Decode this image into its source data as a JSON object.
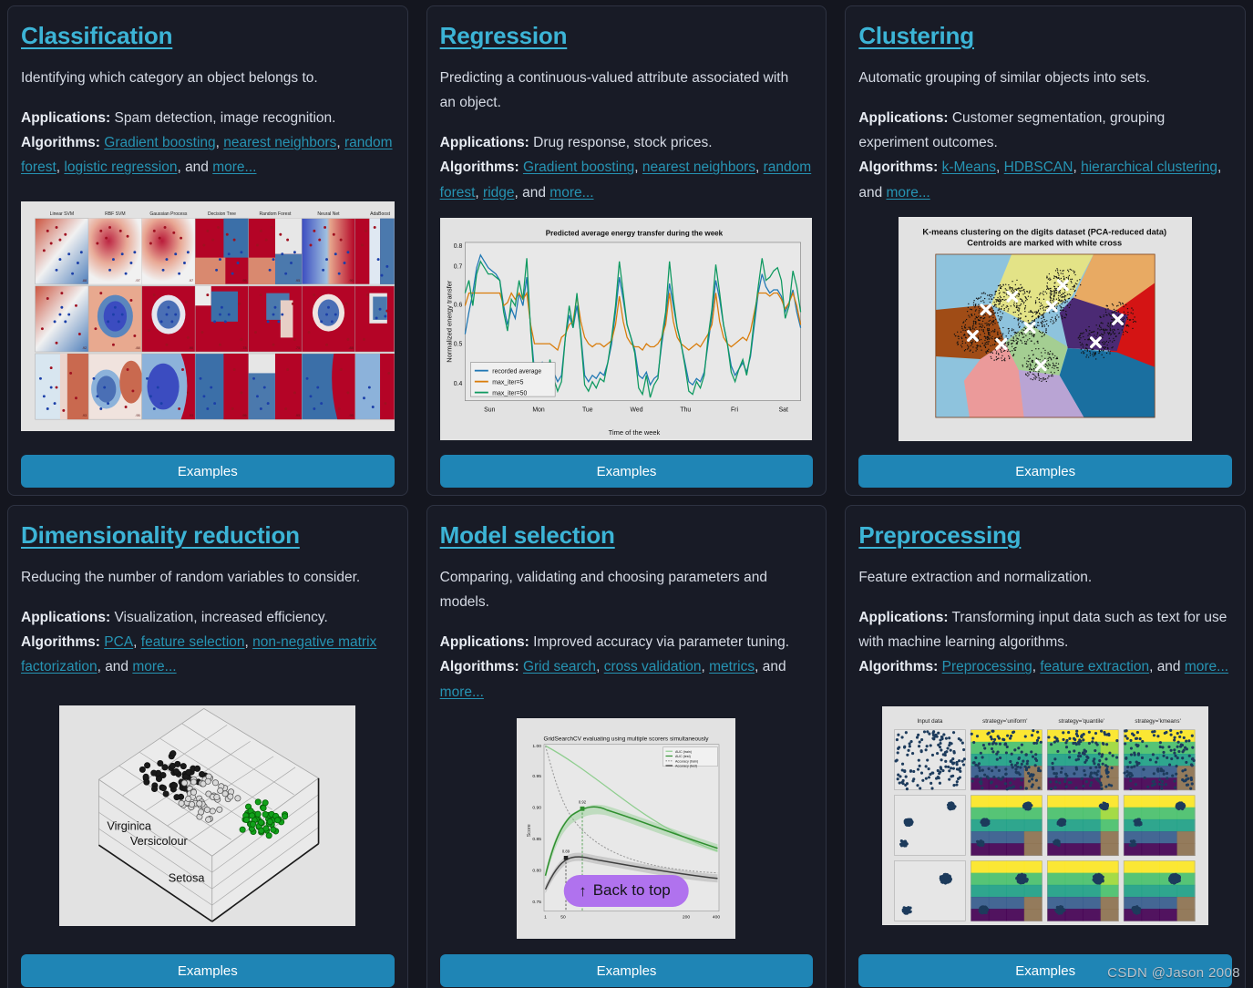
{
  "theme": {
    "page_bg": "#14161f",
    "card_bg": "#181b26",
    "card_border": "#2e3342",
    "heading_color": "#3cb4d6",
    "link_color": "#2694b3",
    "body_text": "#d5dae4",
    "button_bg": "#1f85b5",
    "back_to_top_bg": "#b072ee"
  },
  "labels": {
    "applications": "Applications:",
    "algorithms": "Algorithms:",
    "and": ", and ",
    "comma": ", ",
    "examples": "Examples",
    "back_to_top": "Back to top",
    "back_to_top_arrow": "↑",
    "watermark": "CSDN @Jason 2008"
  },
  "cards": [
    {
      "title": "Classification",
      "description": "Identifying which category an object belongs to.",
      "applications": "Spam detection, image recognition.",
      "algorithms": [
        "Gradient boosting",
        "nearest neighbors",
        "random forest",
        "logistic regression"
      ],
      "more": "more...",
      "button": "Examples",
      "figure": "classifier-comparison"
    },
    {
      "title": "Regression",
      "description": "Predicting a continuous-valued attribute associated with an object.",
      "applications": "Drug response, stock prices.",
      "algorithms": [
        "Gradient boosting",
        "nearest neighbors",
        "random forest",
        "ridge"
      ],
      "more": "more...",
      "button": "Examples",
      "figure": "energy-transfer-lines"
    },
    {
      "title": "Clustering",
      "description": "Automatic grouping of similar objects into sets.",
      "applications": "Customer segmentation, grouping experiment outcomes.",
      "algorithms": [
        "k-Means",
        "HDBSCAN",
        "hierarchical clustering"
      ],
      "more": "more...",
      "button": "Examples",
      "figure": "kmeans-voronoi"
    },
    {
      "title": "Dimensionality reduction",
      "description": "Reducing the number of random variables to consider.",
      "applications": "Visualization, increased efficiency.",
      "algorithms": [
        "PCA",
        "feature selection",
        "non-negative matrix factorization"
      ],
      "more": "more...",
      "button": "Examples",
      "figure": "iris-3d-pca"
    },
    {
      "title": "Model selection",
      "description": "Comparing, validating and choosing parameters and models.",
      "applications": "Improved accuracy via parameter tuning.",
      "algorithms": [
        "Grid search",
        "cross validation",
        "metrics"
      ],
      "more": "more...",
      "button": "Examples",
      "figure": "gridsearch-multiscore"
    },
    {
      "title": "Preprocessing",
      "description": "Feature extraction and normalization.",
      "applications": "Transforming input data such as text for use with machine learning algorithms.",
      "algorithms": [
        "Preprocessing",
        "feature extraction"
      ],
      "more": "more...",
      "button": "Examples",
      "figure": "kbins-discretizer"
    }
  ],
  "chart_data": [
    {
      "id": "classifier-comparison",
      "type": "heatmap",
      "title": "",
      "columns": [
        "Linear SVM",
        "RBF SVM",
        "Gaussian Process",
        "Decision Tree",
        "Random Forest",
        "Neural Net",
        "AdaBoost"
      ],
      "rows": 3,
      "scores": [
        [
          0.88,
          0.97,
          0.97,
          0.95,
          0.95,
          0.9,
          0.92
        ],
        [
          0.92,
          0.88,
          0.9,
          0.78,
          0.75,
          0.88,
          0.9
        ],
        [
          0.93,
          0.95,
          0.93,
          0.95,
          0.95,
          0.95,
          0.93
        ]
      ],
      "class_colors": [
        "#b40426",
        "#3b4cc0"
      ],
      "note": "Classifier comparison decision-boundary grid"
    },
    {
      "id": "energy-transfer-lines",
      "type": "line",
      "title": "Predicted average energy transfer during the week",
      "xlabel": "Time of the week",
      "ylabel": "Normalized energy transfer",
      "categories": [
        "Sun",
        "Mon",
        "Tue",
        "Wed",
        "Thu",
        "Fri",
        "Sat"
      ],
      "yticks": [
        0.4,
        0.5,
        0.6,
        0.7,
        0.8
      ],
      "ylim": [
        0.32,
        0.82
      ],
      "grid": false,
      "legend_position": "lower left",
      "series": [
        {
          "name": "recorded average",
          "color": "#1f77b4",
          "values": [
            0.53,
            0.6,
            0.66,
            0.74,
            0.78,
            0.76,
            0.74,
            0.73,
            0.72,
            0.7,
            0.62,
            0.56,
            0.61,
            0.58,
            0.66,
            0.62,
            0.71,
            0.55,
            0.41,
            0.41,
            0.44,
            0.4,
            0.44,
            0.41,
            0.38,
            0.4,
            0.52,
            0.59,
            0.55,
            0.62,
            0.53,
            0.4,
            0.38,
            0.4,
            0.39,
            0.41,
            0.4,
            0.44,
            0.5,
            0.6,
            0.71,
            0.64,
            0.56,
            0.52,
            0.48,
            0.4,
            0.39,
            0.41,
            0.37,
            0.39,
            0.4,
            0.5,
            0.58,
            0.69,
            0.62,
            0.55,
            0.5,
            0.44,
            0.38,
            0.37,
            0.39,
            0.38,
            0.41,
            0.5,
            0.59,
            0.7,
            0.64,
            0.56,
            0.5,
            0.43,
            0.4,
            0.42,
            0.44,
            0.41,
            0.46,
            0.56,
            0.66,
            0.72,
            0.68,
            0.66,
            0.67,
            0.67,
            0.65,
            0.6,
            0.63,
            0.67,
            0.6,
            0.55
          ]
        },
        {
          "name": "max_iter=5",
          "color": "#d97c0a",
          "values": [
            0.62,
            0.66,
            0.66,
            0.66,
            0.66,
            0.66,
            0.66,
            0.66,
            0.66,
            0.66,
            0.62,
            0.63,
            0.66,
            0.64,
            0.66,
            0.64,
            0.66,
            0.56,
            0.5,
            0.5,
            0.5,
            0.5,
            0.5,
            0.49,
            0.48,
            0.52,
            0.53,
            0.56,
            0.57,
            0.65,
            0.57,
            0.52,
            0.5,
            0.49,
            0.5,
            0.5,
            0.49,
            0.5,
            0.51,
            0.56,
            0.65,
            0.57,
            0.52,
            0.5,
            0.49,
            0.49,
            0.48,
            0.5,
            0.49,
            0.49,
            0.5,
            0.52,
            0.56,
            0.66,
            0.57,
            0.52,
            0.5,
            0.49,
            0.48,
            0.49,
            0.5,
            0.49,
            0.51,
            0.53,
            0.56,
            0.66,
            0.57,
            0.52,
            0.5,
            0.49,
            0.5,
            0.51,
            0.52,
            0.51,
            0.54,
            0.6,
            0.66,
            0.66,
            0.66,
            0.65,
            0.66,
            0.66,
            0.64,
            0.61,
            0.63,
            0.66,
            0.62,
            0.56
          ]
        },
        {
          "name": "max_iter=50",
          "color": "#0f9960",
          "values": [
            0.66,
            0.7,
            0.62,
            0.72,
            0.76,
            0.74,
            0.72,
            0.72,
            0.71,
            0.7,
            0.6,
            0.54,
            0.64,
            0.62,
            0.7,
            0.64,
            0.77,
            0.54,
            0.38,
            0.38,
            0.42,
            0.36,
            0.45,
            0.39,
            0.35,
            0.38,
            0.52,
            0.62,
            0.55,
            0.66,
            0.52,
            0.37,
            0.35,
            0.38,
            0.36,
            0.39,
            0.38,
            0.44,
            0.52,
            0.62,
            0.76,
            0.66,
            0.56,
            0.52,
            0.47,
            0.36,
            0.34,
            0.4,
            0.33,
            0.37,
            0.39,
            0.52,
            0.6,
            0.76,
            0.64,
            0.55,
            0.5,
            0.43,
            0.35,
            0.34,
            0.38,
            0.36,
            0.4,
            0.52,
            0.61,
            0.75,
            0.66,
            0.56,
            0.5,
            0.41,
            0.38,
            0.42,
            0.45,
            0.4,
            0.47,
            0.58,
            0.68,
            0.77,
            0.7,
            0.71,
            0.73,
            0.74,
            0.7,
            0.58,
            0.62,
            0.73,
            0.68,
            0.6
          ]
        }
      ]
    },
    {
      "id": "kmeans-voronoi",
      "type": "scatter",
      "title_line1": "K-means clustering on the digits dataset (PCA-reduced data)",
      "title_line2": "Centroids are marked with white cross",
      "n_clusters": 10,
      "centroid_marker": "white cross",
      "region_colors": [
        "#8ec3dd",
        "#e3e387",
        "#e8aa63",
        "#d41414",
        "#4b2a74",
        "#a4ce92",
        "#1a6fa0",
        "#b9a4d4",
        "#eb9a9a",
        "#a04c16"
      ],
      "centroids": [
        [
          0.58,
          0.19
        ],
        [
          0.35,
          0.26
        ],
        [
          0.23,
          0.34
        ],
        [
          0.83,
          0.4
        ],
        [
          0.53,
          0.32
        ],
        [
          0.43,
          0.45
        ],
        [
          0.73,
          0.54
        ],
        [
          0.17,
          0.5
        ],
        [
          0.3,
          0.55
        ],
        [
          0.48,
          0.68
        ]
      ]
    },
    {
      "id": "iris-3d-pca",
      "type": "scatter",
      "title": "",
      "annotations": [
        "Virginica",
        "Versicolour",
        "Setosa"
      ],
      "group_colors": [
        "#1a1a1a",
        "#cfcfcf",
        "#11a11a"
      ],
      "projection": "3d"
    },
    {
      "id": "gridsearch-multiscore",
      "type": "line",
      "title": "GridSearchCV evaluating using multiple scorers simultaneously",
      "ylabel": "Score",
      "legend": [
        "AUC (train)",
        "AUC (test)",
        "Accuracy (train)",
        "Accuracy (test)"
      ],
      "legend_position": "upper right",
      "xticks": [
        1,
        50,
        200,
        400
      ],
      "yticks": [
        0.75,
        0.8,
        0.85,
        0.9,
        0.95,
        1.0
      ],
      "best_markers": [
        "0.92",
        "0.89"
      ],
      "series": [
        {
          "name": "AUC (train)",
          "color": "#8fce8f",
          "style": "solid"
        },
        {
          "name": "AUC (test)",
          "color": "#2f8f2f",
          "style": "solid"
        },
        {
          "name": "Accuracy (train)",
          "color": "#9a9a9a",
          "style": "dotted"
        },
        {
          "name": "Accuracy (test)",
          "color": "#3f3f3f",
          "style": "solid"
        }
      ]
    },
    {
      "id": "kbins-discretizer",
      "type": "heatmap",
      "columns": [
        "Input data",
        "strategy='uniform'",
        "strategy='quantile'",
        "strategy='kmeans'"
      ],
      "rows": 3,
      "point_color": "#1d3b5c",
      "cmap": "viridis"
    }
  ]
}
